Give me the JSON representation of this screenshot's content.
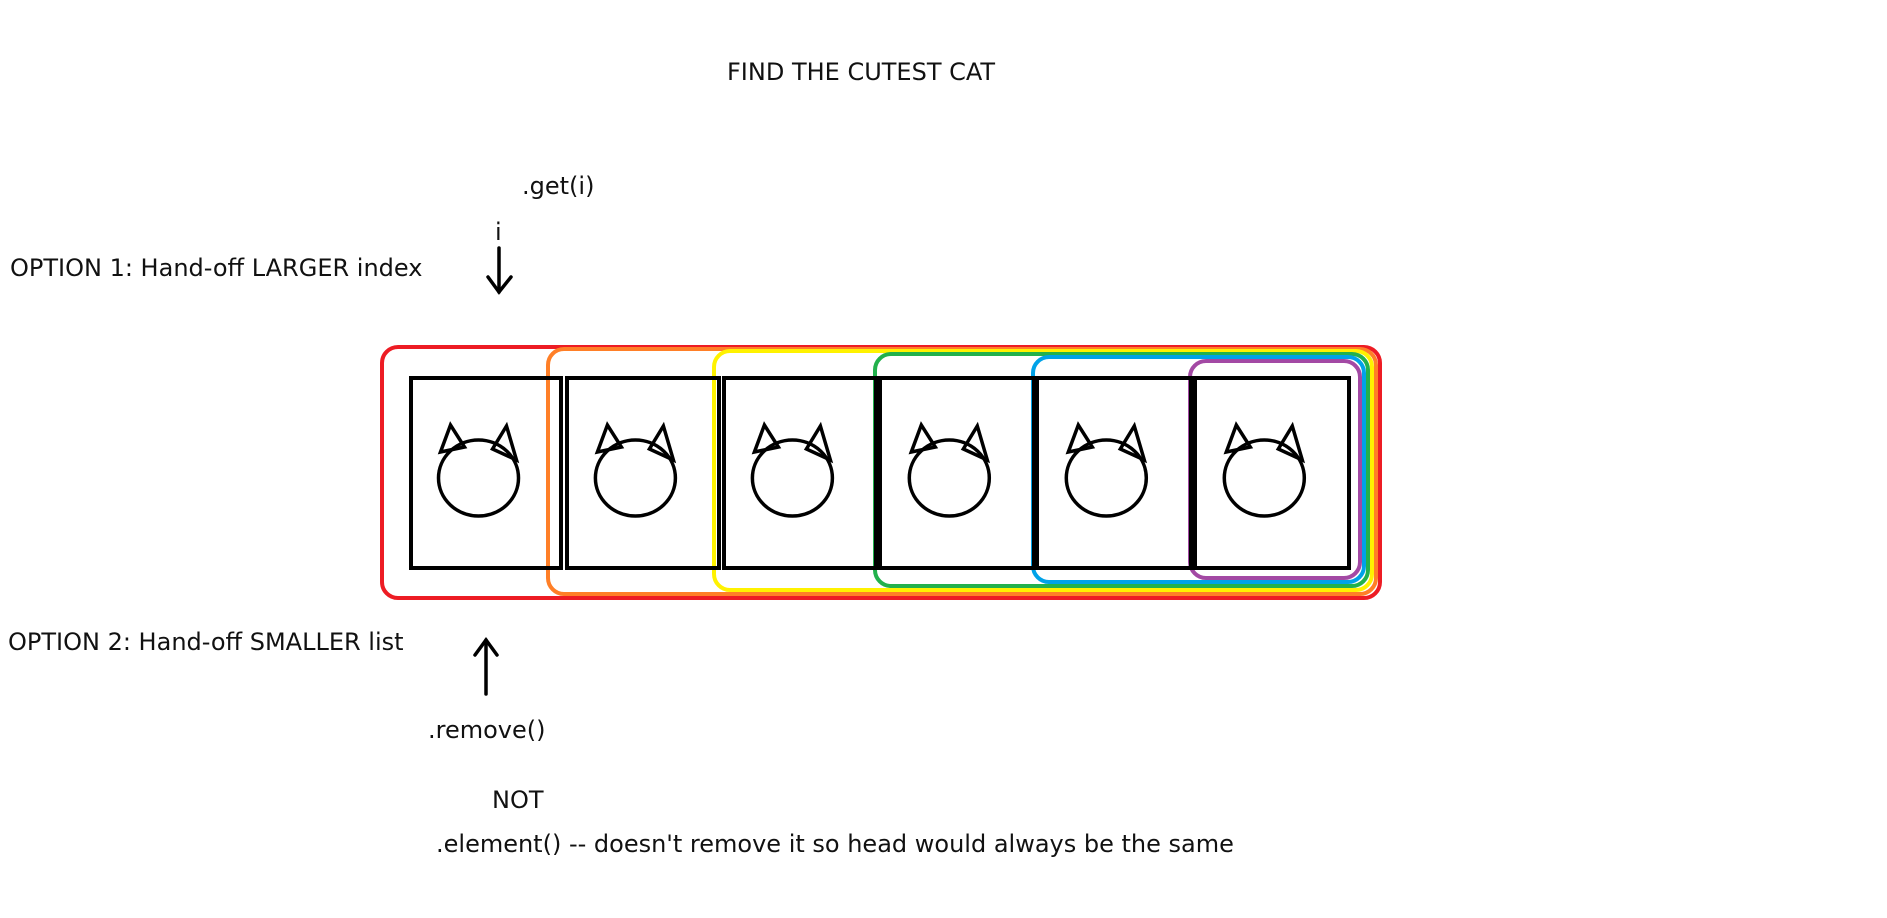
{
  "title": "FIND THE CUTEST CAT",
  "option1": {
    "label": "OPTION 1:  Hand-off LARGER index",
    "method": ".get(i)",
    "index_label": "i"
  },
  "option2": {
    "label": "OPTION 2:  Hand-off SMALLER list",
    "method": ".remove()"
  },
  "note": {
    "not_label": "NOT",
    "alternative": ".element() -- doesn't remove it so head would always be the same"
  },
  "cats": [
    {
      "id": 1
    },
    {
      "id": 2
    },
    {
      "id": 3
    },
    {
      "id": 4
    },
    {
      "id": 5
    },
    {
      "id": 6
    }
  ],
  "sublist_colors": [
    "#ed1c24",
    "#ff7f27",
    "#fff200",
    "#22b14c",
    "#00a2e8",
    "#a349a4"
  ]
}
